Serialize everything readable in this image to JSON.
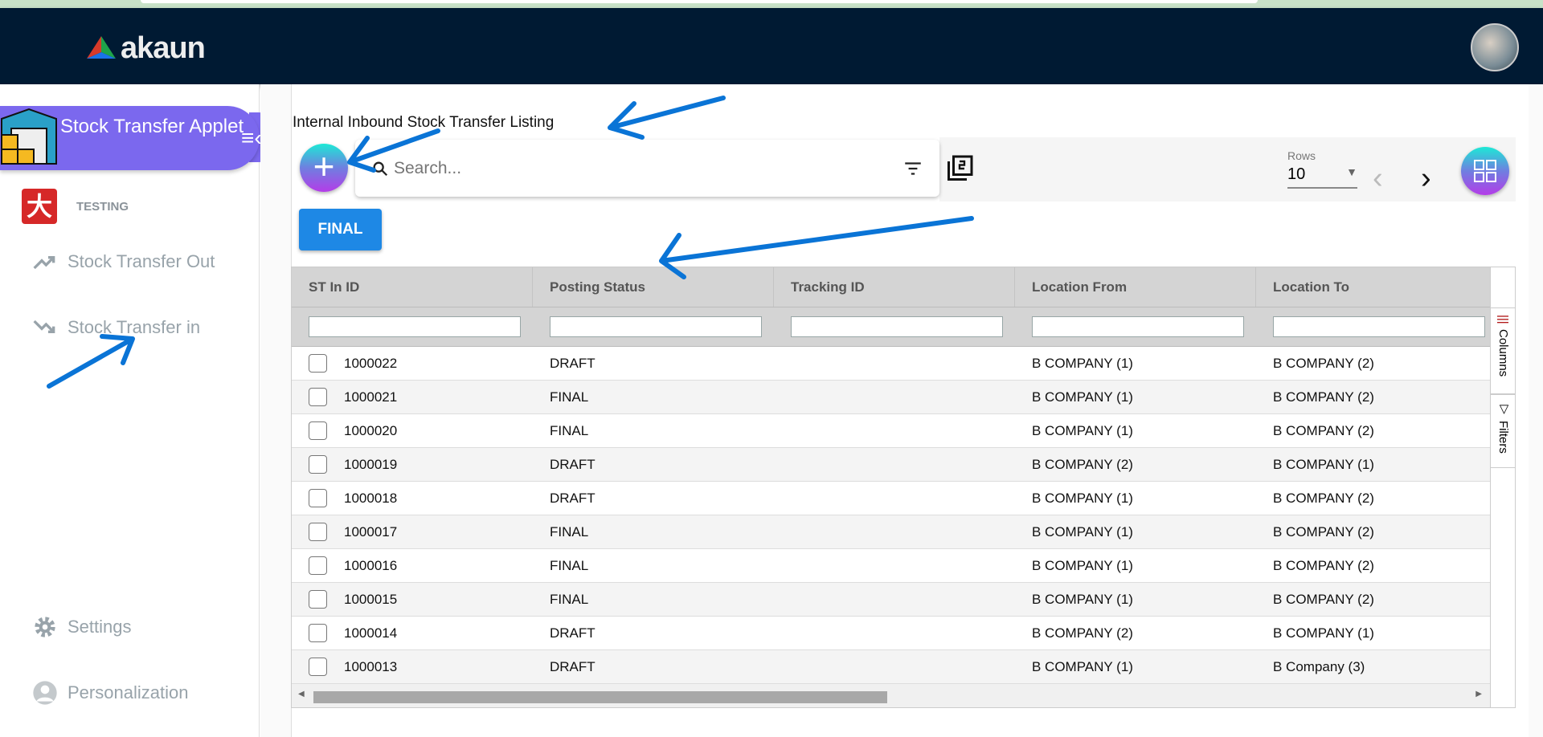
{
  "header": {
    "logo_text": "akaun"
  },
  "sidebar": {
    "applet_title": "Stock Transfer Applet",
    "org_label": "TESTING",
    "nav": [
      {
        "label": "Stock Transfer Out",
        "icon": "trending-up-icon"
      },
      {
        "label": "Stock Transfer in",
        "icon": "trending-down-icon"
      }
    ],
    "settings_label": "Settings",
    "personalization_label": "Personalization"
  },
  "main": {
    "title": "Internal Inbound Stock Transfer Listing",
    "search_placeholder": "Search...",
    "rows_label": "Rows",
    "rows_value": "10",
    "final_button": "FINAL"
  },
  "table": {
    "columns": [
      "ST In ID",
      "Posting Status",
      "Tracking ID",
      "Location From",
      "Location To"
    ],
    "rows": [
      {
        "id": "1000022",
        "status": "DRAFT",
        "tracking": "",
        "from": "B COMPANY (1)",
        "to": "B COMPANY (2)"
      },
      {
        "id": "1000021",
        "status": "FINAL",
        "tracking": "",
        "from": "B COMPANY (1)",
        "to": "B COMPANY (2)"
      },
      {
        "id": "1000020",
        "status": "FINAL",
        "tracking": "",
        "from": "B COMPANY (1)",
        "to": "B COMPANY (2)"
      },
      {
        "id": "1000019",
        "status": "DRAFT",
        "tracking": "",
        "from": "B COMPANY (2)",
        "to": "B COMPANY (1)"
      },
      {
        "id": "1000018",
        "status": "DRAFT",
        "tracking": "",
        "from": "B COMPANY (1)",
        "to": "B COMPANY (2)"
      },
      {
        "id": "1000017",
        "status": "FINAL",
        "tracking": "",
        "from": "B COMPANY (1)",
        "to": "B COMPANY (2)"
      },
      {
        "id": "1000016",
        "status": "FINAL",
        "tracking": "",
        "from": "B COMPANY (1)",
        "to": "B COMPANY (2)"
      },
      {
        "id": "1000015",
        "status": "FINAL",
        "tracking": "",
        "from": "B COMPANY (1)",
        "to": "B COMPANY (2)"
      },
      {
        "id": "1000014",
        "status": "DRAFT",
        "tracking": "",
        "from": "B COMPANY (2)",
        "to": "B COMPANY (1)"
      },
      {
        "id": "1000013",
        "status": "DRAFT",
        "tracking": "",
        "from": "B COMPANY (1)",
        "to": "B Company (3)"
      }
    ],
    "side_tabs": {
      "columns": "Columns",
      "filters": "Filters"
    }
  },
  "colors": {
    "header_bg": "#001a33",
    "applet_purple": "#7b68ee",
    "button_blue": "#1e88e5",
    "annotation_blue": "#0a74d6"
  }
}
